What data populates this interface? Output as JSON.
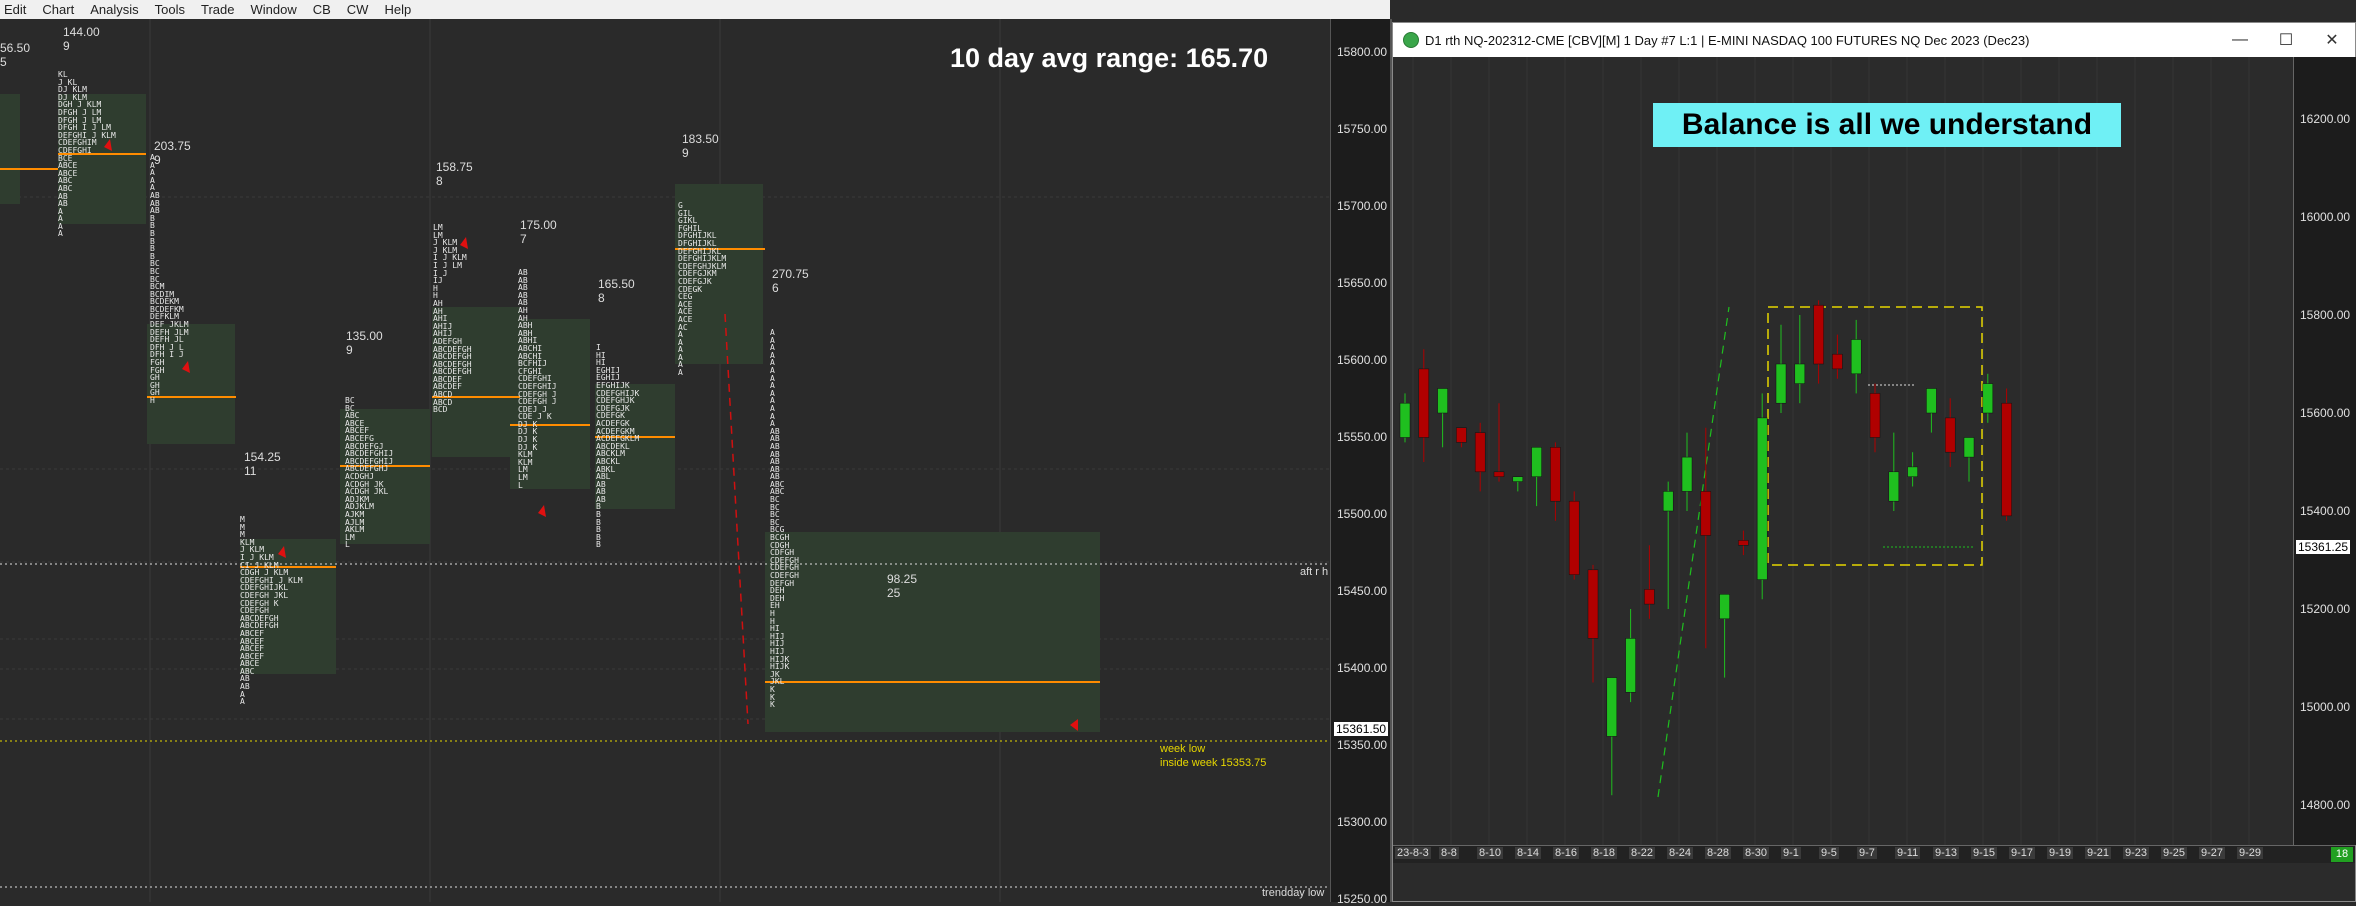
{
  "menu": [
    "Edit",
    "Chart",
    "Analysis",
    "Tools",
    "Trade",
    "Window",
    "CB",
    "CW",
    "Help"
  ],
  "left_chart": {
    "headline": "10 day avg range:  165.70",
    "price_ticks": [
      "15800.00",
      "15750.00",
      "15700.00",
      "15650.00",
      "15600.00",
      "15550.00",
      "15500.00",
      "15450.00",
      "15400.00",
      "15350.00",
      "15300.00",
      "15250.00"
    ],
    "current_price": "15361.50",
    "profiles": [
      {
        "range": "56.50",
        "count": "5"
      },
      {
        "range": "144.00",
        "count": "9"
      },
      {
        "range": "203.75",
        "count": "9"
      },
      {
        "range": "154.25",
        "count": "11"
      },
      {
        "range": "135.00",
        "count": "9"
      },
      {
        "range": "158.75",
        "count": "8"
      },
      {
        "range": "175.00",
        "count": "7"
      },
      {
        "range": "165.50",
        "count": "8"
      },
      {
        "range": "183.50",
        "count": "9"
      },
      {
        "range": "270.75",
        "count": "6"
      },
      {
        "range": "98.25",
        "count": "25"
      }
    ],
    "labels": {
      "aft_rh": "aft r h",
      "week_low": "week low",
      "inside_week": "inside week  15353.75",
      "trendday_low": "trendday low"
    }
  },
  "right_window": {
    "title": "D1 rth NQ-202312-CME [CBV][M]  1 Day  #7 L:1 | E-MINI NASDAQ 100 FUTURES NQ Dec 2023 (Dec23)",
    "banner": "Balance is all we understand",
    "price_ticks": [
      "16200.00",
      "16000.00",
      "15800.00",
      "15600.00",
      "15400.00",
      "15200.00",
      "15000.00",
      "14800.00"
    ],
    "current_price": "15361.25",
    "x_labels": [
      "23-8-3",
      "8-8",
      "8-10",
      "8-14",
      "8-16",
      "8-18",
      "8-22",
      "8-24",
      "8-28",
      "8-30",
      "9-1",
      "9-5",
      "9-7",
      "9-11",
      "9-13",
      "9-15",
      "9-17",
      "9-19",
      "9-21",
      "9-23",
      "9-25",
      "9-27",
      "9-29"
    ],
    "badge": "18",
    "colors": {
      "up": "#1fbf1f",
      "down": "#b00000",
      "box": "#e6d600",
      "banner": "#6ff0f5"
    }
  },
  "chart_data": {
    "type": "candlestick",
    "title": "",
    "ylim": [
      14760,
      16300
    ],
    "candles": [
      {
        "o": 15550,
        "h": 15640,
        "l": 15540,
        "c": 15620
      },
      {
        "o": 15690,
        "h": 15730,
        "l": 15500,
        "c": 15550
      },
      {
        "o": 15600,
        "h": 15620,
        "l": 15530,
        "c": 15650
      },
      {
        "o": 15570,
        "h": 15560,
        "l": 15530,
        "c": 15540
      },
      {
        "o": 15560,
        "h": 15580,
        "l": 15440,
        "c": 15480
      },
      {
        "o": 15480,
        "h": 15620,
        "l": 15460,
        "c": 15470
      },
      {
        "o": 15460,
        "h": 15470,
        "l": 15440,
        "c": 15470
      },
      {
        "o": 15470,
        "h": 15530,
        "l": 15410,
        "c": 15530
      },
      {
        "o": 15530,
        "h": 15540,
        "l": 15380,
        "c": 15420
      },
      {
        "o": 15420,
        "h": 15440,
        "l": 15260,
        "c": 15270
      },
      {
        "o": 15280,
        "h": 15290,
        "l": 15050,
        "c": 15140
      },
      {
        "o": 14940,
        "h": 15060,
        "l": 14820,
        "c": 15060
      },
      {
        "o": 15030,
        "h": 15200,
        "l": 15010,
        "c": 15140
      },
      {
        "o": 15240,
        "h": 15330,
        "l": 15180,
        "c": 15210
      },
      {
        "o": 15400,
        "h": 15460,
        "l": 15200,
        "c": 15440
      },
      {
        "o": 15440,
        "h": 15560,
        "l": 15400,
        "c": 15510
      },
      {
        "o": 15440,
        "h": 15570,
        "l": 15120,
        "c": 15350
      },
      {
        "o": 15180,
        "h": 15220,
        "l": 15060,
        "c": 15230
      },
      {
        "o": 15340,
        "h": 15360,
        "l": 15310,
        "c": 15330
      },
      {
        "o": 15260,
        "h": 15640,
        "l": 15220,
        "c": 15590
      },
      {
        "o": 15620,
        "h": 15780,
        "l": 15600,
        "c": 15700
      },
      {
        "o": 15660,
        "h": 15800,
        "l": 15620,
        "c": 15700
      },
      {
        "o": 15820,
        "h": 15830,
        "l": 15660,
        "c": 15700
      },
      {
        "o": 15720,
        "h": 15760,
        "l": 15670,
        "c": 15690
      },
      {
        "o": 15680,
        "h": 15790,
        "l": 15640,
        "c": 15750
      },
      {
        "o": 15640,
        "h": 15660,
        "l": 15520,
        "c": 15550
      },
      {
        "o": 15420,
        "h": 15560,
        "l": 15400,
        "c": 15480
      },
      {
        "o": 15470,
        "h": 15520,
        "l": 15450,
        "c": 15490
      },
      {
        "o": 15600,
        "h": 15640,
        "l": 15560,
        "c": 15650
      },
      {
        "o": 15590,
        "h": 15630,
        "l": 15490,
        "c": 15520
      },
      {
        "o": 15510,
        "h": 15550,
        "l": 15460,
        "c": 15550
      },
      {
        "o": 15600,
        "h": 15680,
        "l": 15580,
        "c": 15660
      },
      {
        "o": 15620,
        "h": 15650,
        "l": 15380,
        "c": 15390
      }
    ]
  }
}
